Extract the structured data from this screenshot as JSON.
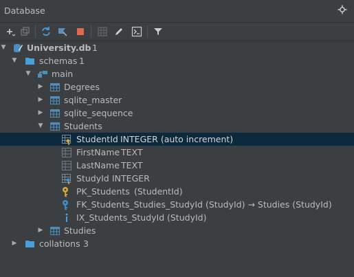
{
  "panel": {
    "title": "Database"
  },
  "toolbar": {
    "icons": [
      "add-icon",
      "duplicate-icon",
      "refresh-icon",
      "properties-icon",
      "stop-icon",
      "table-icon",
      "edit-icon",
      "console-icon",
      "filter-icon"
    ]
  },
  "tree": {
    "db": {
      "label": "University.db",
      "count": "1"
    },
    "schemas": {
      "label": "schemas",
      "count": "1"
    },
    "main": {
      "label": "main"
    },
    "tables": [
      "Degrees",
      "sqlite_master",
      "sqlite_sequence",
      "Students"
    ],
    "students_children": [
      {
        "name": "StudentId",
        "type": "INTEGER (auto increment)"
      },
      {
        "name": "FirstName",
        "type": "TEXT"
      },
      {
        "name": "LastName",
        "type": "TEXT"
      },
      {
        "name": "StudyId",
        "type": "INTEGER"
      },
      {
        "name": "PK_Students",
        "type": "(StudentId)"
      },
      {
        "name": "FK_Students_Studies_StudyId",
        "type": "(StudyId) → Studies (StudyId)"
      },
      {
        "name": "IX_Students_StudyId",
        "type": "(StudyId)"
      }
    ],
    "studies": {
      "label": "Studies"
    },
    "collations": {
      "label": "collations",
      "count": "3"
    }
  },
  "colors": {
    "selection": "#0d293e",
    "table_icon": "#4c8fbd",
    "key": "#d6a936",
    "fk": "#3d8fd0",
    "stop": "#e0694e"
  }
}
